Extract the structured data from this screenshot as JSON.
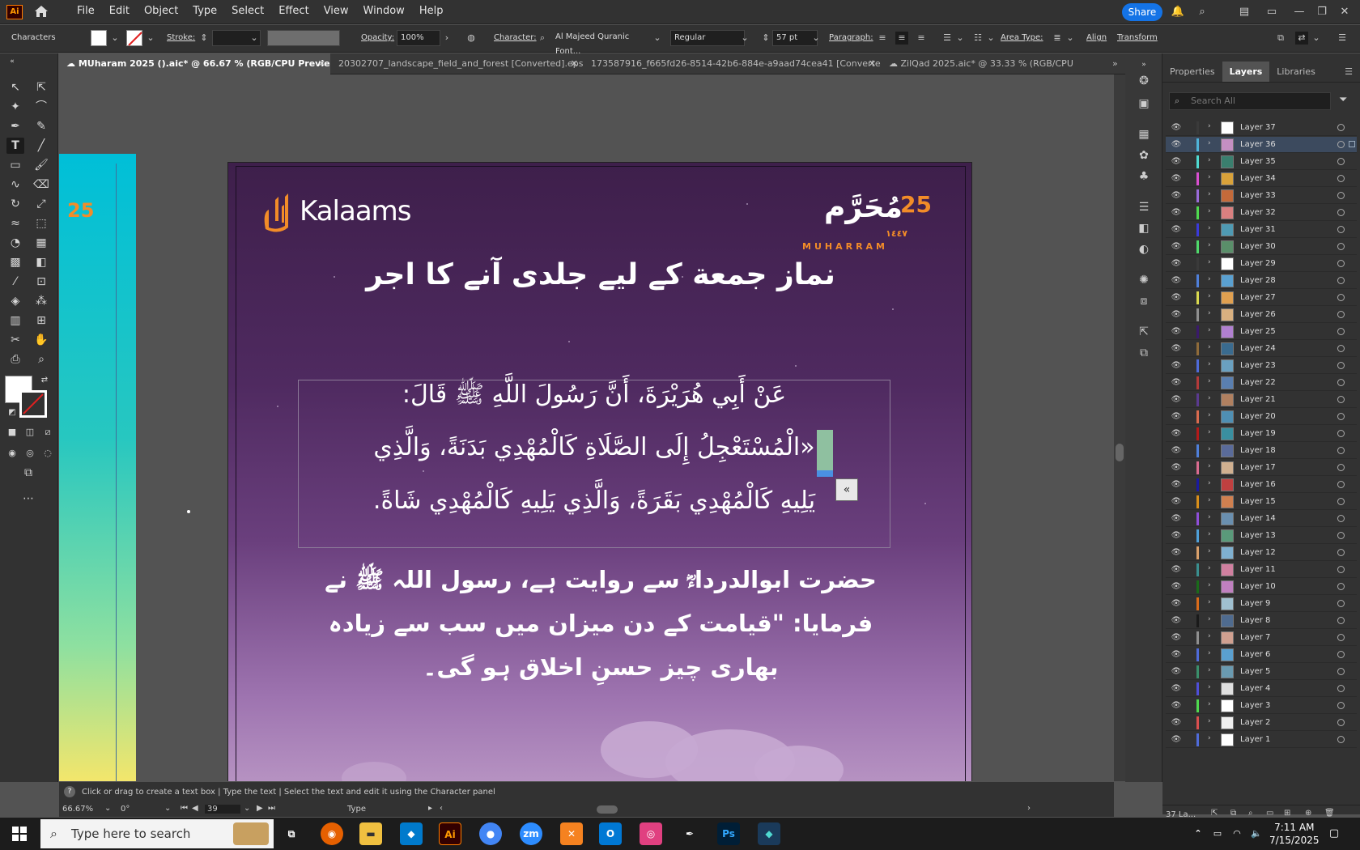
{
  "app": {
    "logo": "Ai"
  },
  "menu": [
    "File",
    "Edit",
    "Object",
    "Type",
    "Select",
    "Effect",
    "View",
    "Window",
    "Help"
  ],
  "share_label": "Share",
  "control": {
    "characters": "Characters",
    "stroke": "Stroke:",
    "opacity_label": "Opacity:",
    "opacity_value": "100%",
    "character_label": "Character:",
    "font": "Al Majeed Quranic Font...",
    "style": "Regular",
    "size": "57 pt",
    "paragraph": "Paragraph:",
    "area_type": "Area Type:",
    "align": "Align",
    "transform": "Transform"
  },
  "tabs": [
    "MUharam 2025 ().aic* @ 66.67 % (RGB/CPU Preview)",
    "20302707_landscape_field_and_forest [Converted].eps*",
    "173587916_f665fd26-8514-42b6-884e-a9aad74cea41 [Converted].eps*",
    "ZilQad 2025.aic* @ 33.33 % (RGB/CPU"
  ],
  "artboard": {
    "left_number": "25",
    "logo_word": "Kalaams",
    "muharram_number": "25",
    "muharram_ar": "مُحَرَّم",
    "muharram_year": "١٤٤٧",
    "muharram_en": "MUHARRAM",
    "heading": "نماز جمعة کے لیے جلدی آنے کا اجر",
    "arabic_line1": "عَنْ أَبِي هُرَيْرَةَ، أَنَّ رَسُولَ اللَّهِ ﷺ قَالَ:",
    "arabic_line2": "«الْمُسْتَعْجِلُ إِلَى الصَّلَاةِ كَالْمُهْدِي بَدَنَةً، وَالَّذِي",
    "arabic_line3": "يَلِيهِ كَالْمُهْدِي بَقَرَةً، وَالَّذِي يَلِيهِ كَالْمُهْدِي شَاةً.",
    "overflow_glyph": "«",
    "urdu_line1": "حضرت ابوالدرداءؓ سے روایت ہے، رسول اللہ ﷺ نے",
    "urdu_line2": "فرمایا: \"قیامت کے دن میزان میں سب سے زیادہ",
    "urdu_line3": "بھاری چیز حسنِ اخلاق ہو گی۔"
  },
  "panel_tabs": [
    "Properties",
    "Layers",
    "Libraries"
  ],
  "layers_search_placeholder": "Search All",
  "layers": [
    {
      "name": "Layer 37",
      "color": "#3a3a3a",
      "thumb": "#ffffff"
    },
    {
      "name": "Layer 36",
      "color": "#4fb3d9",
      "thumb": "#c48fc2"
    },
    {
      "name": "Layer 35",
      "color": "#4fd9d0",
      "thumb": "#3a7f6e"
    },
    {
      "name": "Layer 34",
      "color": "#d94fd0",
      "thumb": "#d9a23a"
    },
    {
      "name": "Layer 33",
      "color": "#9a6bd9",
      "thumb": "#c46a3a"
    },
    {
      "name": "Layer 32",
      "color": "#4fd94f",
      "thumb": "#d98080"
    },
    {
      "name": "Layer 31",
      "color": "#3a3ad9",
      "thumb": "#4f9ab3"
    },
    {
      "name": "Layer 30",
      "color": "#4fd96b",
      "thumb": "#5a8f6a"
    },
    {
      "name": "Layer 29",
      "color": "#3a3a3a",
      "thumb": "#ffffff"
    },
    {
      "name": "Layer 28",
      "color": "#4f7fd9",
      "thumb": "#5aa0d0"
    },
    {
      "name": "Layer 27",
      "color": "#d9d94f",
      "thumb": "#e0a050"
    },
    {
      "name": "Layer 26",
      "color": "#8f8f8f",
      "thumb": "#d9b080"
    },
    {
      "name": "Layer 25",
      "color": "#3a1a6b",
      "thumb": "#b080d0"
    },
    {
      "name": "Layer 24",
      "color": "#8f6b3a",
      "thumb": "#3a6b8f"
    },
    {
      "name": "Layer 23",
      "color": "#4f6bd9",
      "thumb": "#6aa0c0"
    },
    {
      "name": "Layer 22",
      "color": "#b33a3a",
      "thumb": "#5a7fb0"
    },
    {
      "name": "Layer 21",
      "color": "#5a3a8f",
      "thumb": "#b08060"
    },
    {
      "name": "Layer 20",
      "color": "#d96b4f",
      "thumb": "#4f8fb3"
    },
    {
      "name": "Layer 19",
      "color": "#b31a1a",
      "thumb": "#3a8fa0"
    },
    {
      "name": "Layer 18",
      "color": "#4f7fd9",
      "thumb": "#5a6b9a"
    },
    {
      "name": "Layer 17",
      "color": "#d96b8f",
      "thumb": "#d0b090"
    },
    {
      "name": "Layer 16",
      "color": "#1a1aa0",
      "thumb": "#c04040"
    },
    {
      "name": "Layer 15",
      "color": "#d98f1a",
      "thumb": "#d08050"
    },
    {
      "name": "Layer 14",
      "color": "#8f4fd9",
      "thumb": "#6a8faf"
    },
    {
      "name": "Layer 13",
      "color": "#4fa0d9",
      "thumb": "#5a9a7a"
    },
    {
      "name": "Layer 12",
      "color": "#d9a06b",
      "thumb": "#7fb0d0"
    },
    {
      "name": "Layer 11",
      "color": "#3a8f8f",
      "thumb": "#d080a0"
    },
    {
      "name": "Layer 10",
      "color": "#1a6b1a",
      "thumb": "#c080c0"
    },
    {
      "name": "Layer 9",
      "color": "#d96b1a",
      "thumb": "#a0c0d0"
    },
    {
      "name": "Layer 8",
      "color": "#1a1a1a",
      "thumb": "#4f6b8f"
    },
    {
      "name": "Layer 7",
      "color": "#8f8f8f",
      "thumb": "#d0a090"
    },
    {
      "name": "Layer 6",
      "color": "#4f6bd9",
      "thumb": "#5aa0d0"
    },
    {
      "name": "Layer 5",
      "color": "#3a8f6b",
      "thumb": "#6a9ab0"
    },
    {
      "name": "Layer 4",
      "color": "#4f4fd9",
      "thumb": "#e0e0e0"
    },
    {
      "name": "Layer 3",
      "color": "#4fd94f",
      "thumb": "#ffffff"
    },
    {
      "name": "Layer 2",
      "color": "#d94f4f",
      "thumb": "#f0f0f0"
    },
    {
      "name": "Layer 1",
      "color": "#4f6bd9",
      "thumb": "#ffffff"
    }
  ],
  "layers_count": "37 La...",
  "status": {
    "hint": "Click or drag to create a text box  |  Type the text  |  Select the text and edit it using the Character panel",
    "zoom": "66.67%",
    "rotate": "0°",
    "artboard_num": "39",
    "tool": "Type"
  },
  "taskbar": {
    "search_placeholder": "Type here to search",
    "time": "7:11 AM",
    "date": "7/15/2025"
  }
}
